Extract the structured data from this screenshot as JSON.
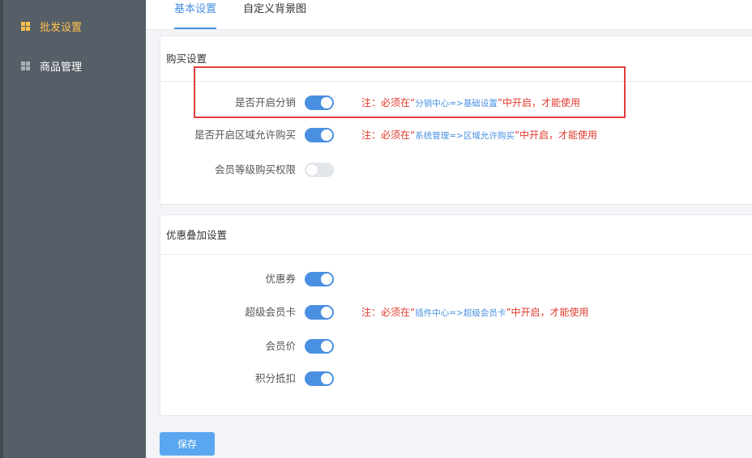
{
  "sidebar": {
    "items": [
      {
        "label": "批发设置",
        "icon": "grid-icon",
        "active": true
      },
      {
        "label": "商品管理",
        "icon": "grid-icon",
        "active": false
      }
    ]
  },
  "tabs": [
    {
      "label": "基本设置",
      "active": true
    },
    {
      "label": "自定义背景图",
      "active": false
    }
  ],
  "purchase": {
    "title": "购买设置",
    "rows": [
      {
        "label": "是否开启分销",
        "switch_on": true,
        "note_prefix": "注：必须在“",
        "note_ref": "分销中心=>基础设置",
        "note_suffix": "”中开启，才能使用"
      },
      {
        "label": "是否开启区域允许购买",
        "switch_on": true,
        "note_prefix": "注：必须在“",
        "note_ref": "系统管理=>区域允许购买",
        "note_suffix": "”中开启，才能使用"
      },
      {
        "label": "会员等级购买权限",
        "switch_on": false
      }
    ]
  },
  "discount": {
    "title": "优惠叠加设置",
    "rows": [
      {
        "label": "优惠券",
        "switch_on": true
      },
      {
        "label": "超级会员卡",
        "switch_on": true,
        "note_prefix": "注：必须在“",
        "note_ref": "插件中心=>超级会员卡",
        "note_suffix": "”中开启，才能使用"
      },
      {
        "label": "会员价",
        "switch_on": true
      },
      {
        "label": "积分抵扣",
        "switch_on": true
      }
    ]
  },
  "save_label": "保存",
  "colors": {
    "accent": "#4a90e2",
    "sidebar": "#565f67",
    "active_menu": "#ffc24d",
    "note": "#e0382b",
    "highlight": "#e23c3c"
  }
}
